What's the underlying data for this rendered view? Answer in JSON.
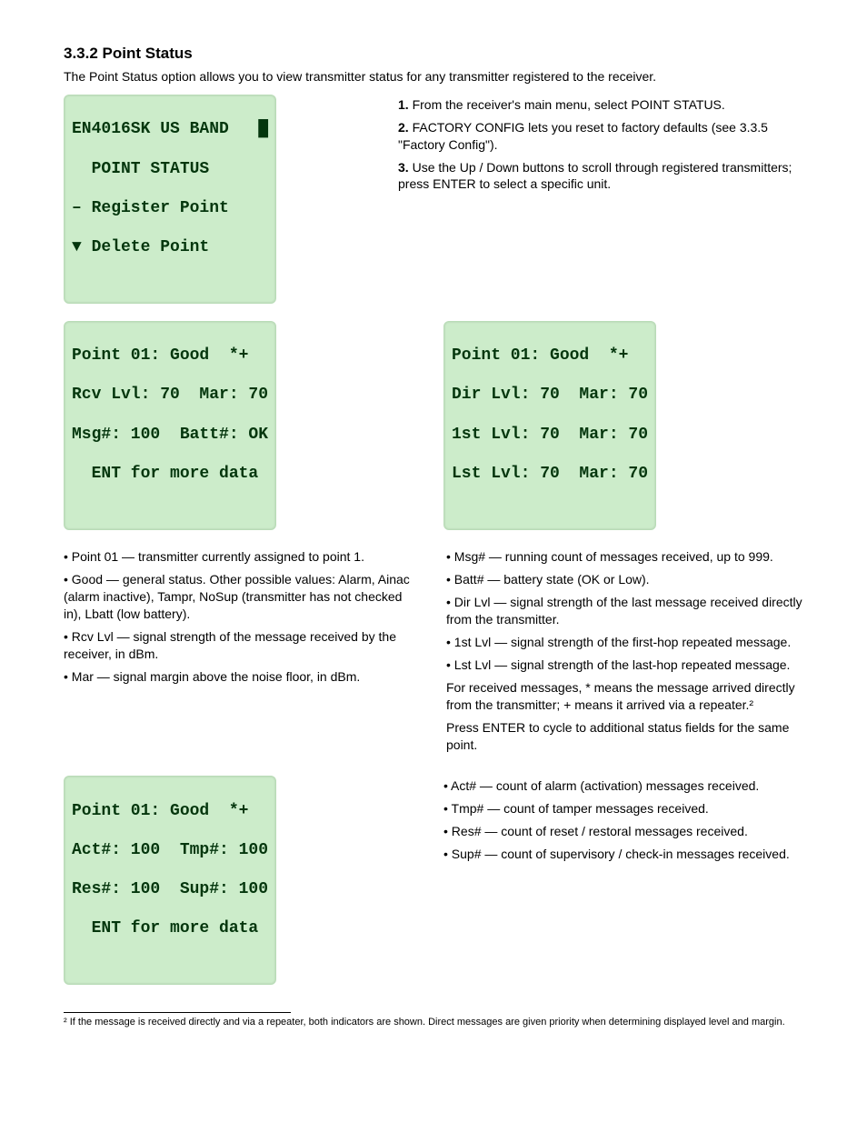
{
  "title_point_status": "3.3.2 Point Status",
  "point_status_intro": "The Point Status option allows you to view transmitter status for any transmitter registered to the receiver.",
  "lcd_menu": {
    "l1": "EN4016SK US BAND   █",
    "l2": "  POINT STATUS",
    "l3": "– Register Point",
    "l4": "▼ Delete Point"
  },
  "step_list": [
    "From the receiver's main menu, select POINT STATUS.",
    "FACTORY CONFIG lets you reset to factory defaults (see 3.3.5 \"Factory Config\").",
    "Use the Up / Down buttons to scroll through registered transmitters; press ENTER to select a specific unit."
  ],
  "lcd_status_primary": {
    "l1": "Point 01: Good  *+",
    "l2": "Rcv Lvl: 70  Mar: 70",
    "l3": "Msg#: 100  Batt#: OK",
    "l4": "  ENT for more data"
  },
  "lcd_status_hops": {
    "l1": "Point 01: Good  *+",
    "l2": "Dir Lvl: 70  Mar: 70",
    "l3": "1st Lvl: 70  Mar: 70",
    "l4": "Lst Lvl: 70  Mar: 70"
  },
  "col_left_bullets": [
    "Point 01 — transmitter currently assigned to point 1.",
    "Good — general status. Other possible values: Alarm, Ainac (alarm inactive), Tampr, NoSup (transmitter has not checked in), Lbatt (low battery).",
    "Rcv Lvl — signal strength of the message received by the receiver, in dBm.",
    "Mar — signal margin above the noise floor, in dBm."
  ],
  "col_right_bullets": [
    "Msg# — running count of messages received, up to 999.",
    "Batt# — battery state (OK or Low).",
    "Dir Lvl — signal strength of the last message received directly from the transmitter.",
    "1st Lvl — signal strength of the first-hop repeated message.",
    "Lst Lvl — signal strength of the last-hop repeated message."
  ],
  "col_right_text1": "For received messages, * means the message arrived directly from the transmitter; + means it arrived via a repeater.²",
  "col_right_text2": "Press ENTER to cycle to additional status fields for the same point.",
  "lcd_status_counts": {
    "l1": "Point 01: Good  *+",
    "l2": "Act#: 100  Tmp#: 100",
    "l3": "Res#: 100  Sup#: 100",
    "l4": "  ENT for more data"
  },
  "counts_bullets": [
    "Act# — count of alarm (activation) messages received.",
    "Tmp# — count of tamper messages received.",
    "Res# — count of reset / restoral messages received.",
    "Sup# — count of supervisory / check-in messages received."
  ],
  "footnote_text": "² If the message is received directly and via a repeater, both indicators are shown. Direct messages are given priority when determining displayed level and margin."
}
